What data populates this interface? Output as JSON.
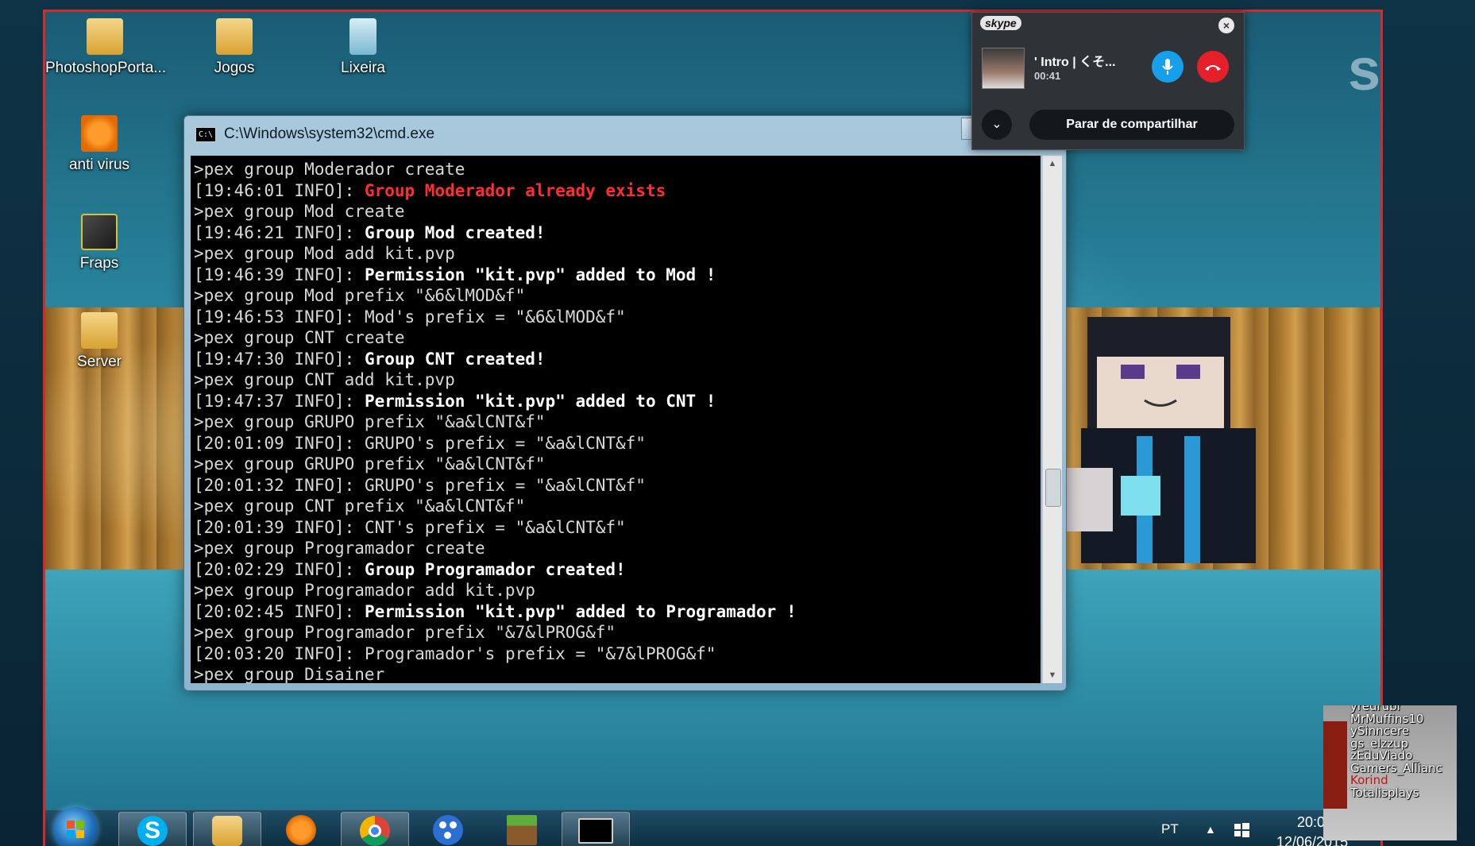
{
  "desktop": {
    "icons": [
      {
        "label": "PhotoshopPorta..."
      },
      {
        "label": "Jogos"
      },
      {
        "label": "Lixeira"
      },
      {
        "label": "anti virus"
      },
      {
        "label": "Fraps"
      },
      {
        "label": "Server"
      }
    ],
    "watermark": "skype"
  },
  "cmd": {
    "title": "C:\\Windows\\system32\\cmd.exe",
    "icon_text": "C:\\",
    "lines": [
      {
        "text": ">pex group Moderador create"
      },
      {
        "prefix": "[19:46:01 INFO]: ",
        "text": "Group Moderador already exists",
        "style": "err"
      },
      {
        "text": ">pex group Mod create"
      },
      {
        "prefix": "[19:46:21 INFO]: ",
        "text": "Group Mod created!",
        "style": "hl"
      },
      {
        "text": ">pex group Mod add kit.pvp"
      },
      {
        "prefix": "[19:46:39 INFO]: ",
        "text": "Permission \"kit.pvp\" added to Mod !",
        "style": "hl"
      },
      {
        "text": ">pex group Mod prefix \"&6&lMOD&f\""
      },
      {
        "prefix": "[19:46:53 INFO]: ",
        "text": "Mod's prefix = \"&6&lMOD&f\""
      },
      {
        "text": ">pex group CNT create"
      },
      {
        "prefix": "[19:47:30 INFO]: ",
        "text": "Group CNT created!",
        "style": "hl"
      },
      {
        "text": ">pex group CNT add kit.pvp"
      },
      {
        "prefix": "[19:47:37 INFO]: ",
        "text": "Permission \"kit.pvp\" added to CNT !",
        "style": "hl"
      },
      {
        "text": ">pex group GRUPO prefix \"&a&lCNT&f\""
      },
      {
        "prefix": "[20:01:09 INFO]: ",
        "text": "GRUPO's prefix = \"&a&lCNT&f\""
      },
      {
        "text": ">pex group GRUPO prefix \"&a&lCNT&f\""
      },
      {
        "prefix": "[20:01:32 INFO]: ",
        "text": "GRUPO's prefix = \"&a&lCNT&f\""
      },
      {
        "text": ">pex group CNT prefix \"&a&lCNT&f\""
      },
      {
        "prefix": "[20:01:39 INFO]: ",
        "text": "CNT's prefix = \"&a&lCNT&f\""
      },
      {
        "text": ">pex group Programador create"
      },
      {
        "prefix": "[20:02:29 INFO]: ",
        "text": "Group Programador created!",
        "style": "hl"
      },
      {
        "text": ">pex group Programador add kit.pvp"
      },
      {
        "prefix": "[20:02:45 INFO]: ",
        "text": "Permission \"kit.pvp\" added to Programador !",
        "style": "hl"
      },
      {
        "text": ">pex group Programador prefix \"&7&lPROG&f\""
      },
      {
        "prefix": "[20:03:20 INFO]: ",
        "text": "Programador's prefix = \"&7&lPROG&f\""
      },
      {
        "text": ">pex group Disainer"
      }
    ]
  },
  "skype": {
    "logo": "skype",
    "contact_name": "' Intro | くそ...",
    "call_time": "00:41",
    "stop_sharing_label": "Parar de compartilhar"
  },
  "taskbar": {
    "lang": "PT",
    "time": "20:0",
    "date": "12/06/2015"
  },
  "overlay": {
    "names": [
      "yredrubr",
      "MrMuffins10",
      "ySinncere",
      "gs_elzzup",
      "zEduViado_",
      "Gamers_Allianc",
      "Korind",
      "Totalisplays"
    ]
  },
  "colors": {
    "share_border": "#d8282c",
    "error_text": "#ff2e2e",
    "skype_blue": "#16a0ec",
    "skype_red": "#e5202b"
  }
}
